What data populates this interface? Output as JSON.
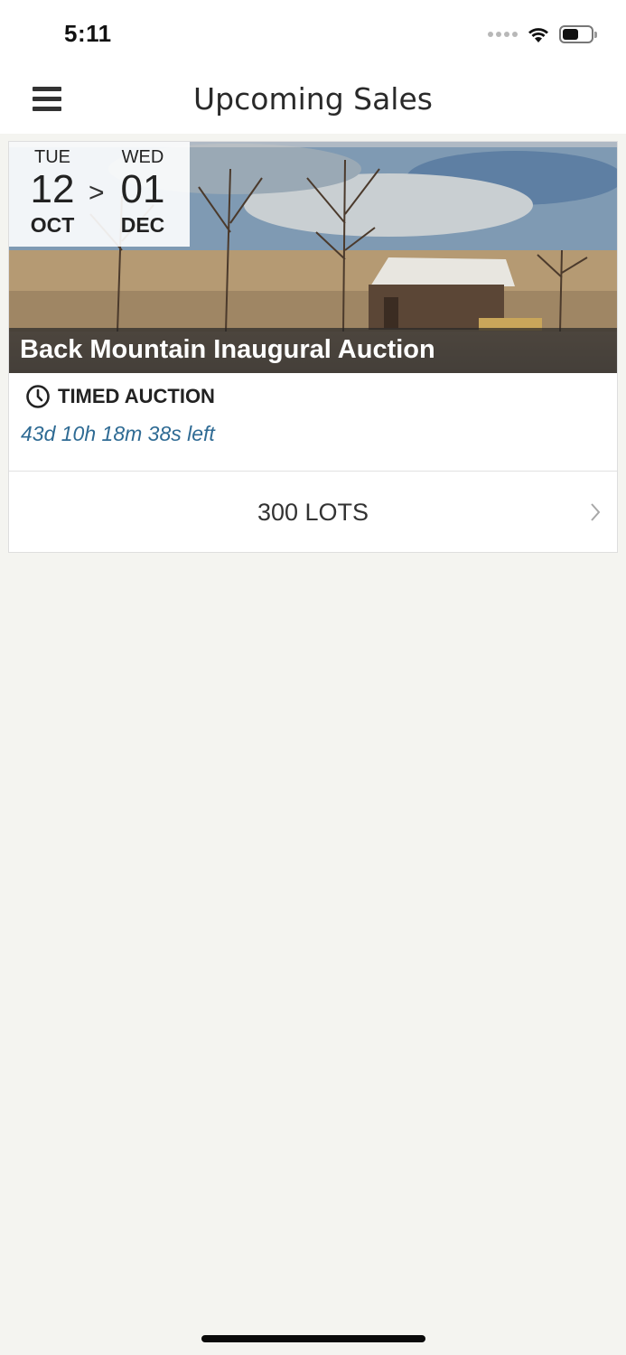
{
  "status_bar": {
    "time": "5:11",
    "icons": [
      "signal-dots-icon",
      "wifi-icon",
      "battery-icon"
    ],
    "battery_level": 0.55
  },
  "nav": {
    "title": "Upcoming Sales",
    "menu_icon": "hamburger-menu-icon"
  },
  "sale": {
    "start": {
      "dow": "TUE",
      "day": "12",
      "month": "OCT"
    },
    "separator": ">",
    "end": {
      "dow": "WED",
      "day": "01",
      "month": "DEC"
    },
    "title": "Back Mountain Inaugural Auction",
    "type_icon": "clock-icon",
    "type": "TIMED AUCTION",
    "time_left": "43d 10h 18m 38s left",
    "lots": "300 LOTS",
    "lots_icon": "chevron-right-icon"
  },
  "colors": {
    "accent": "#2f6b94",
    "background": "#f4f4f0"
  }
}
